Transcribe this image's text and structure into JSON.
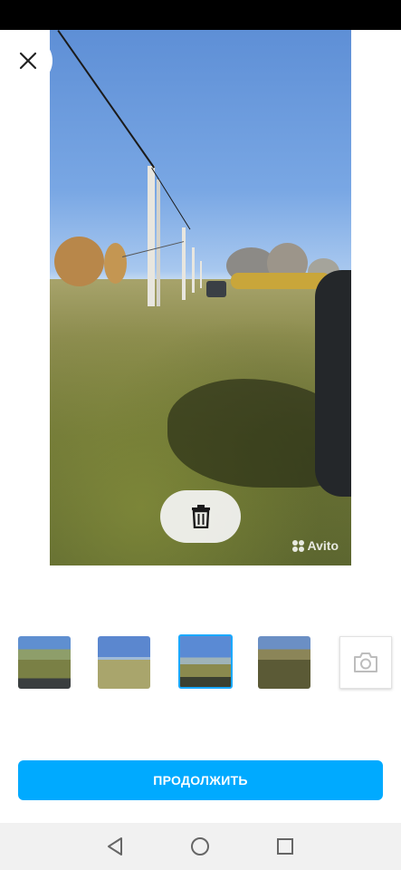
{
  "toolbar": {
    "close_icon": "close-icon",
    "delete_icon": "trash-icon"
  },
  "photo": {
    "watermark_text": "Avito"
  },
  "thumbnails": [
    {
      "id": "photo-1",
      "selected": false
    },
    {
      "id": "photo-2",
      "selected": false
    },
    {
      "id": "photo-3",
      "selected": true
    },
    {
      "id": "photo-4",
      "selected": false
    }
  ],
  "camera_button": {
    "icon": "camera-icon"
  },
  "continue_button": {
    "label": "ПРОДОЛЖИТЬ"
  },
  "colors": {
    "accent": "#00aaff",
    "thumbnail_selected_border": "#1aa9ff"
  },
  "nav": {
    "back_icon": "back-triangle-icon",
    "home_icon": "home-circle-icon",
    "recents_icon": "recents-square-icon"
  }
}
